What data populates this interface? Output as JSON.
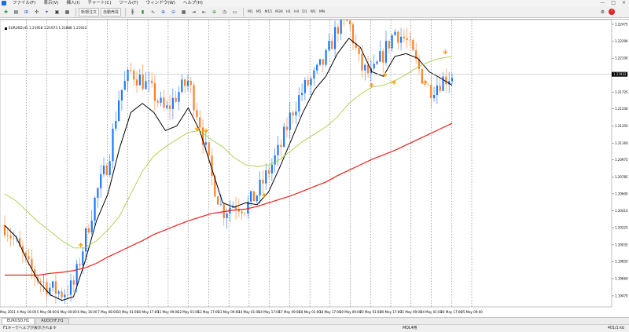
{
  "menubar": {
    "items": [
      "ファイル(F)",
      "表示(V)",
      "挿入(I)",
      "チャート(C)",
      "ツール(T)",
      "ウィンドウ(W)",
      "ヘルプ(H)"
    ],
    "controls": [
      "—",
      "□",
      "×"
    ]
  },
  "toolbar": {
    "new_order_label": "新規注文",
    "autotrade_label": "自動売買",
    "timeframes": [
      "M1",
      "M5",
      "M15",
      "M30",
      "H1",
      "H4",
      "D1",
      "W1",
      "MN"
    ],
    "icons": [
      "new-chart-icon",
      "profiles-icon",
      "market-watch-icon",
      "data-window-icon",
      "navigator-icon",
      "terminal-icon",
      "tester-icon",
      "bar-chart-icon",
      "candle-chart-icon",
      "line-chart-icon",
      "zoom-in-icon",
      "zoom-out-icon",
      "tile-windows-icon",
      "auto-scroll-icon",
      "chart-shift-icon",
      "indicators-icon",
      "periods-icon",
      "templates-icon",
      "options-icon",
      "alert-icon"
    ]
  },
  "chart": {
    "info": "EURUSD,H1  1.21958 1.21973 1.21888 1.21922",
    "colors": {
      "bull": "#1f77ff",
      "bear": "#ff7f27",
      "ma_fast": "#000000",
      "ma_mid": "#9acd32",
      "ma_slow": "#e8201a",
      "arrow": "#f2a112",
      "price_line": "#b0b0b0"
    }
  },
  "chart_data": {
    "type": "candlestick",
    "symbol": "EURUSD",
    "timeframe": "H1",
    "current_price": 1.21922,
    "ylim": [
      1.194,
      1.22475
    ],
    "y_ticks": [
      "1.22475",
      "1.22290",
      "1.22100",
      "1.21920",
      "1.21725",
      "1.21540",
      "1.21350",
      "1.21160",
      "1.20975",
      "1.20785",
      "1.20600",
      "1.20410",
      "1.20225",
      "1.20035",
      "1.19850",
      "1.19660",
      "1.19470"
    ],
    "x_ticks": [
      "4 May 2021",
      "4 May 16:00",
      "5 May 08:00",
      "6 May 00:00",
      "6 May 16:00",
      "7 May 08:00",
      "10 May 01:00",
      "10 May 17:00",
      "11 May 09:00",
      "12 May 01:00",
      "12 May 17:00",
      "13 May 09:00",
      "14 May 01:00",
      "14 May 17:00",
      "17 May 09:00",
      "18 May 01:00",
      "18 May 17:00",
      "19 May 09:00",
      "20 May 01:00",
      "20 May 17:00",
      "21 May 09:00",
      "24 May 01:00",
      "24 May 17:00",
      "25 May 09:00"
    ],
    "series": [
      {
        "name": "MA fast",
        "values": [
          1.2025,
          1.2012,
          1.1985,
          1.1962,
          1.1948,
          1.1942,
          1.1946,
          1.1985,
          1.203,
          1.206,
          1.211,
          1.215,
          1.216,
          1.215,
          1.213,
          1.2135,
          1.2155,
          1.213,
          1.209,
          1.205,
          1.2045,
          1.205,
          1.2048,
          1.2062,
          1.209,
          1.212,
          1.215,
          1.2175,
          1.219,
          1.2215,
          1.2232,
          1.2222,
          1.2195,
          1.219,
          1.2212,
          1.2215,
          1.221,
          1.2195,
          1.2188,
          1.218
        ]
      },
      {
        "name": "MA mid",
        "values": [
          1.206,
          1.2052,
          1.204,
          1.2028,
          1.2018,
          1.2008,
          1.2,
          1.2,
          1.2008,
          1.202,
          1.2035,
          1.206,
          1.2085,
          1.2102,
          1.2112,
          1.212,
          1.2128,
          1.213,
          1.212,
          1.2112,
          1.21,
          1.2092,
          1.209,
          1.2092,
          1.2098,
          1.2108,
          1.2118,
          1.2126,
          1.2134,
          1.2145,
          1.216,
          1.217,
          1.2178,
          1.218,
          1.2185,
          1.2192,
          1.22,
          1.2206,
          1.221,
          1.2212
        ]
      },
      {
        "name": "MA slow",
        "values": [
          1.197,
          1.197,
          1.197,
          1.197,
          1.1972,
          1.1973,
          1.1975,
          1.1978,
          1.1983,
          1.199,
          1.1996,
          1.2002,
          1.2008,
          1.2015,
          1.202,
          1.2025,
          1.203,
          1.2034,
          1.2038,
          1.204,
          1.2042,
          1.2043,
          1.2046,
          1.205,
          1.2054,
          1.2058,
          1.2063,
          1.2068,
          1.2073,
          1.208,
          1.2086,
          1.2092,
          1.2098,
          1.2103,
          1.2108,
          1.2114,
          1.212,
          1.2126,
          1.2132,
          1.2138
        ]
      }
    ],
    "candles_close": [
      1.2025,
      1.2005,
      1.198,
      1.1965,
      1.1955,
      1.195,
      1.1958,
      1.201,
      1.206,
      1.2095,
      1.217,
      1.2195,
      1.2185,
      1.217,
      1.215,
      1.217,
      1.2185,
      1.214,
      1.208,
      1.204,
      1.205,
      1.2045,
      1.206,
      1.2085,
      1.211,
      1.215,
      1.2175,
      1.219,
      1.221,
      1.2245,
      1.225,
      1.22,
      1.219,
      1.2215,
      1.224,
      1.223,
      1.22,
      1.2175,
      1.2185,
      1.2192
    ]
  },
  "tabs": [
    "EURUSD,H1",
    "AUDCHF,H1"
  ],
  "status": {
    "help": "F1キーでヘルプが表示されます",
    "mql": "MQL4用",
    "traffic": "401/1 kb"
  }
}
